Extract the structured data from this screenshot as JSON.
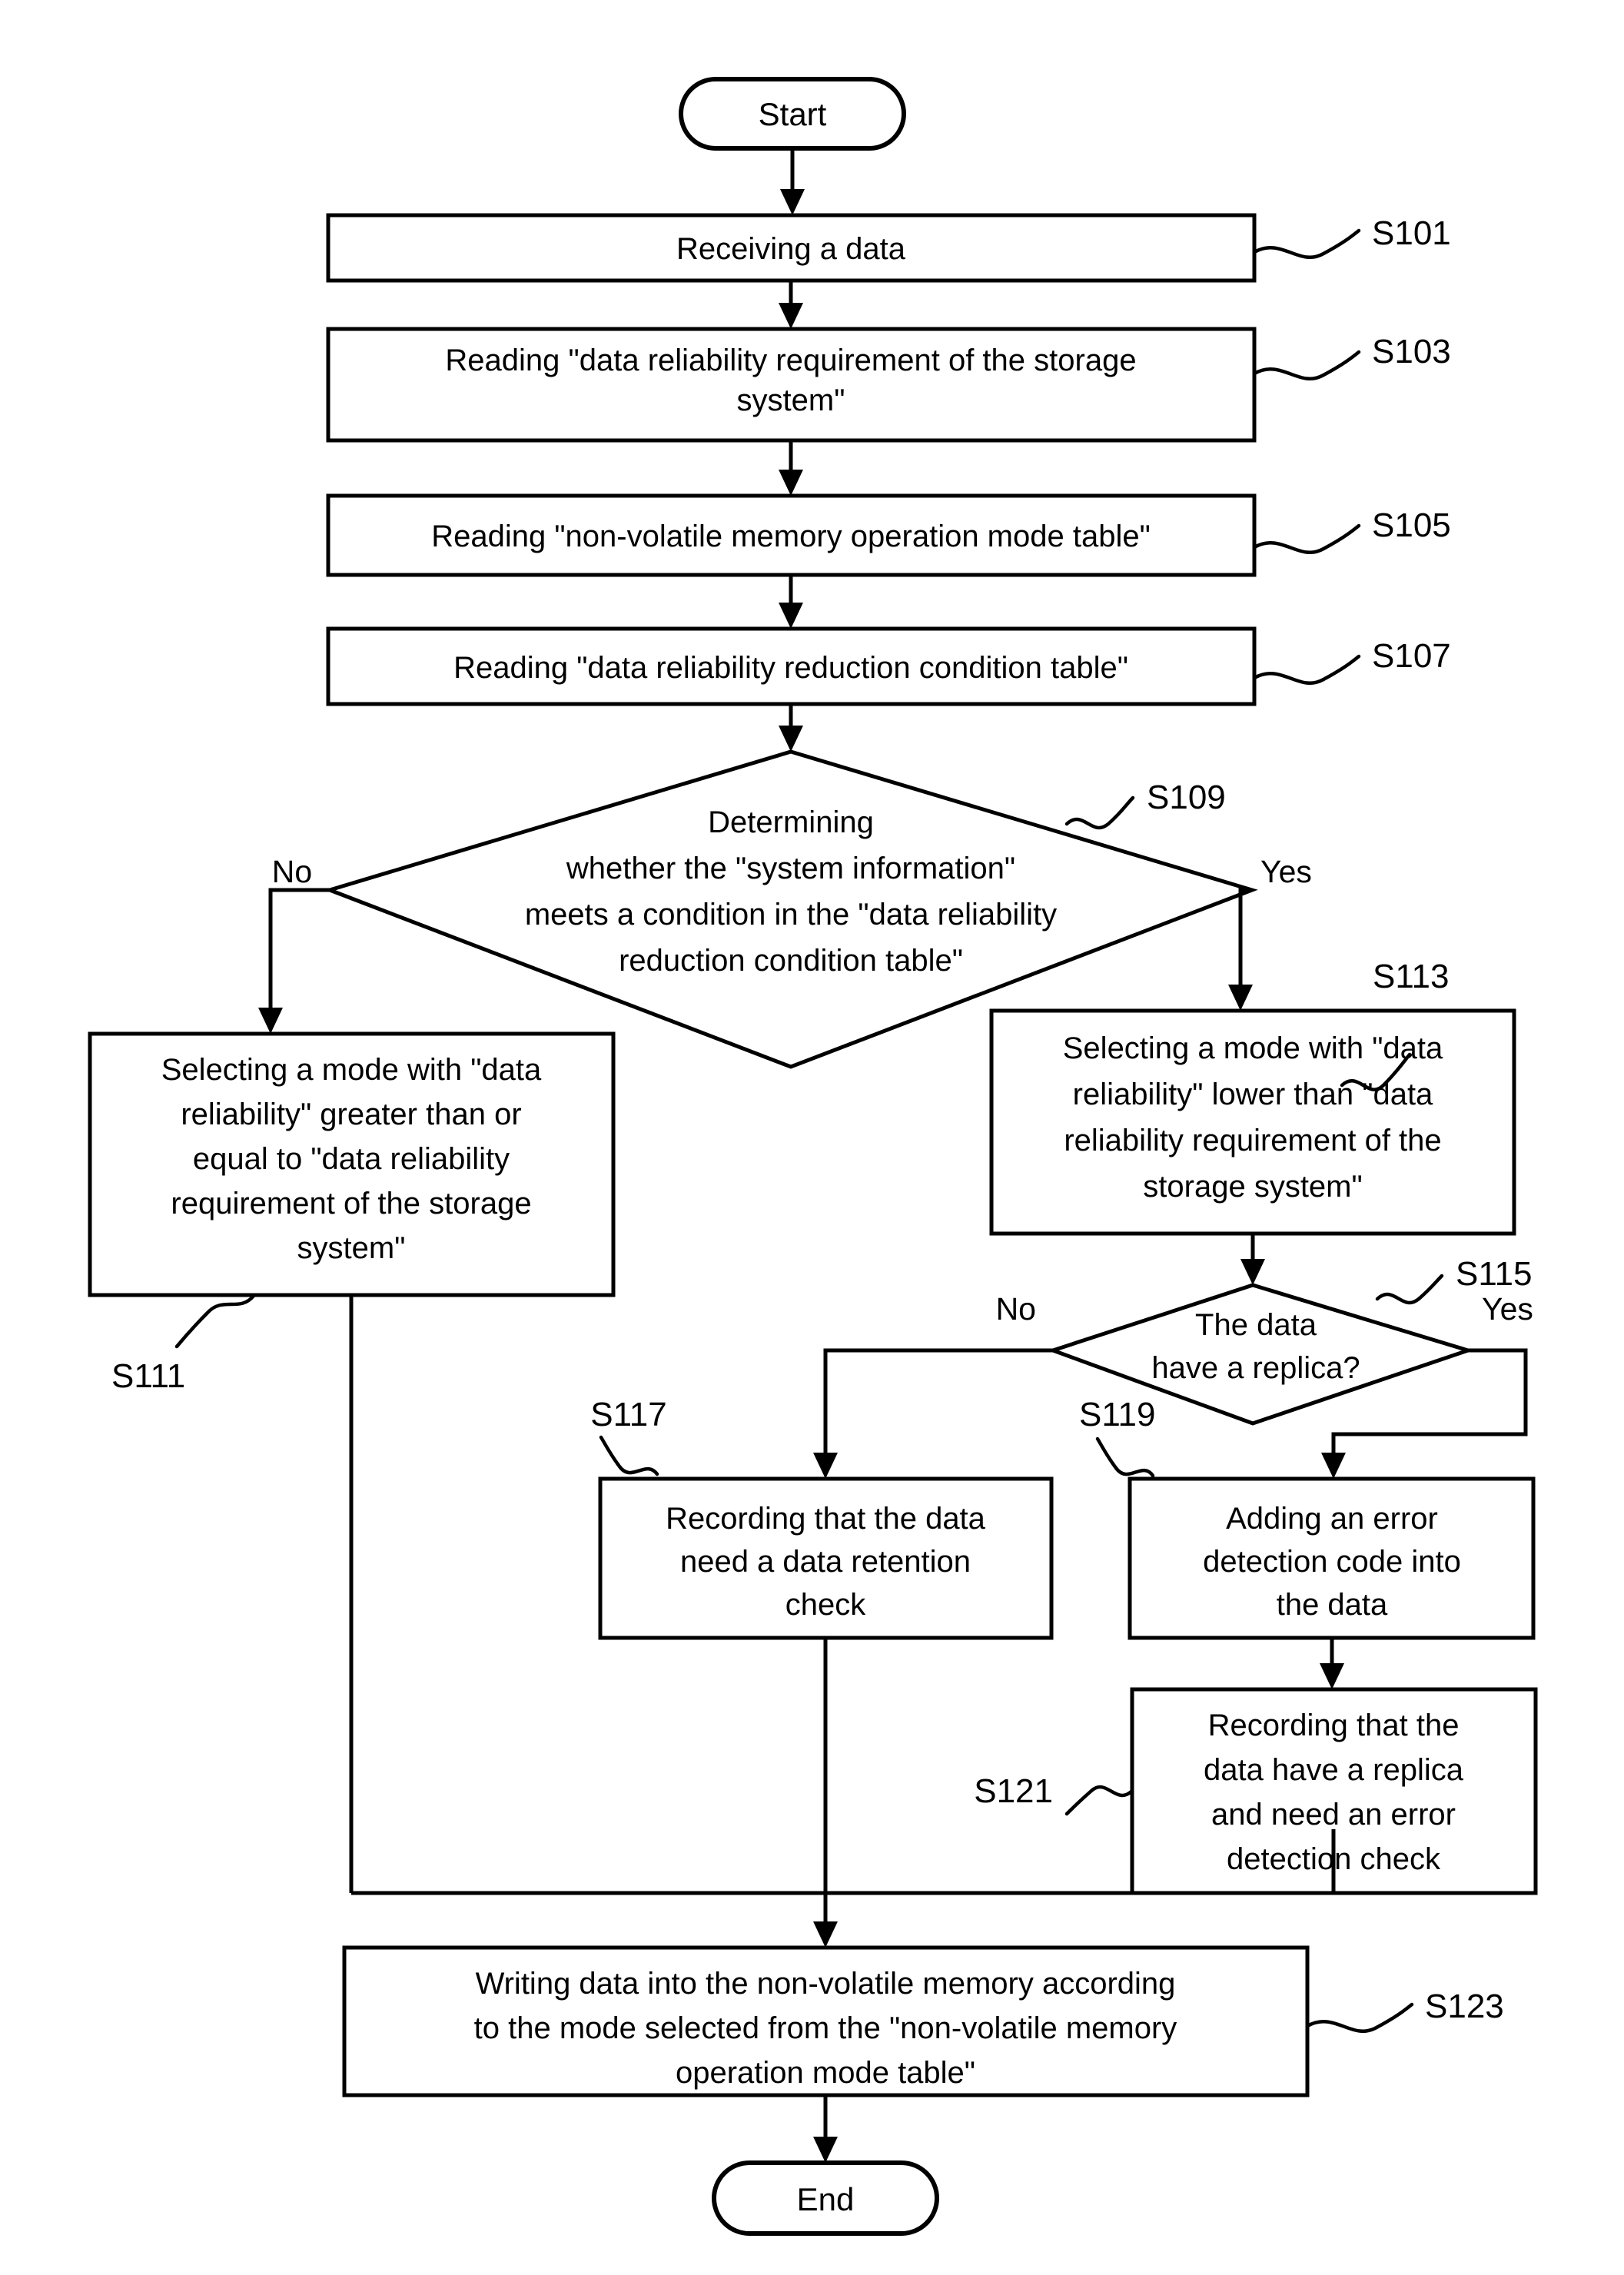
{
  "diagram": {
    "type": "flowchart",
    "title": "Storage system data write flow with reliability mode selection",
    "orientation": "top-to-bottom"
  },
  "terminators": {
    "start": "Start",
    "end": "End"
  },
  "branch_labels": {
    "s109_no": "No",
    "s109_yes": "Yes",
    "s115_no": "No",
    "s115_yes": "Yes"
  },
  "nodes": {
    "s101": {
      "step": "S101",
      "shape": "process",
      "lines": [
        "Receiving a data"
      ]
    },
    "s103": {
      "step": "S103",
      "shape": "process",
      "lines": [
        "Reading \"data reliability requirement of the storage",
        "system\""
      ]
    },
    "s105": {
      "step": "S105",
      "shape": "process",
      "lines": [
        "Reading \"non-volatile memory operation mode table\""
      ]
    },
    "s107": {
      "step": "S107",
      "shape": "process",
      "lines": [
        "Reading \"data reliability reduction condition table\""
      ]
    },
    "s109": {
      "step": "S109",
      "shape": "decision",
      "lines": [
        "Determining",
        "whether the \"system information\"",
        "meets a condition in the \"data reliability",
        "reduction condition table\""
      ]
    },
    "s111": {
      "step": "S111",
      "shape": "process",
      "lines": [
        "Selecting a mode with \"data",
        "reliability\" greater than or",
        "equal to \"data reliability",
        "requirement of the storage",
        "system\""
      ]
    },
    "s113": {
      "step": "S113",
      "shape": "process",
      "lines": [
        "Selecting a mode with \"data",
        "reliability\" lower than \"data",
        "reliability requirement of the",
        "storage system\""
      ]
    },
    "s115": {
      "step": "S115",
      "shape": "decision",
      "lines": [
        "The data",
        "have a replica?"
      ]
    },
    "s117": {
      "step": "S117",
      "shape": "process",
      "lines": [
        "Recording that the data",
        "need a data retention",
        "check"
      ]
    },
    "s119": {
      "step": "S119",
      "shape": "process",
      "lines": [
        "Adding an error",
        "detection code into",
        "the data"
      ]
    },
    "s121": {
      "step": "S121",
      "shape": "process",
      "lines": [
        "Recording that the",
        "data have a replica",
        "and need an error",
        "detection check"
      ]
    },
    "s123": {
      "step": "S123",
      "shape": "process",
      "lines": [
        "Writing data into the non-volatile memory according",
        "to the mode selected  from the \"non-volatile memory",
        "operation mode table\""
      ]
    }
  },
  "colors": {
    "stroke": "#000000",
    "fill": "#ffffff",
    "text": "#000000"
  }
}
